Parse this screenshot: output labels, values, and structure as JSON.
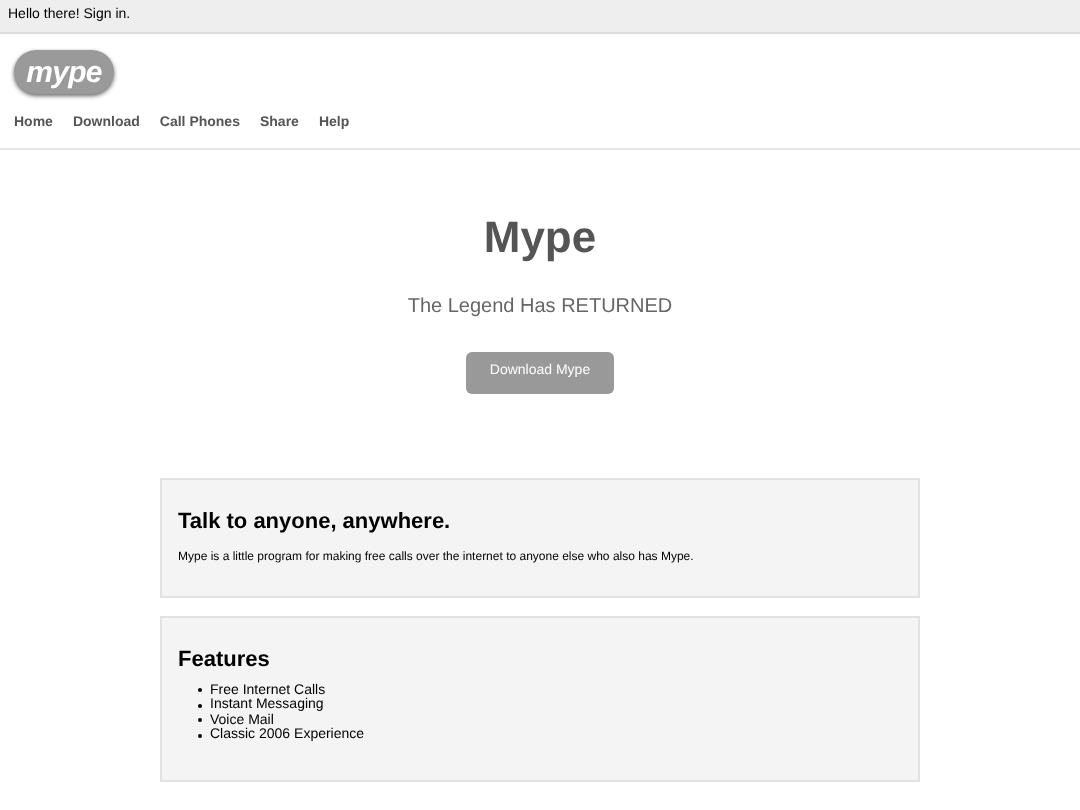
{
  "top_bar": {
    "text": "Hello there! Sign in."
  },
  "logo": {
    "text": "mype"
  },
  "nav": [
    "Home",
    "Download",
    "Call Phones",
    "Share",
    "Help"
  ],
  "hero": {
    "title": "Mype",
    "subtitle": "The Legend Has RETURNED",
    "button": "Download Mype"
  },
  "intro": {
    "heading": "Talk to anyone, anywhere.",
    "text": "Mype is a little program for making free calls over the internet to anyone else who also has Mype."
  },
  "features": {
    "heading": "Features",
    "items": [
      "Free Internet Calls",
      "Instant Messaging",
      "Voice Mail",
      "Classic 2006 Experience"
    ]
  }
}
